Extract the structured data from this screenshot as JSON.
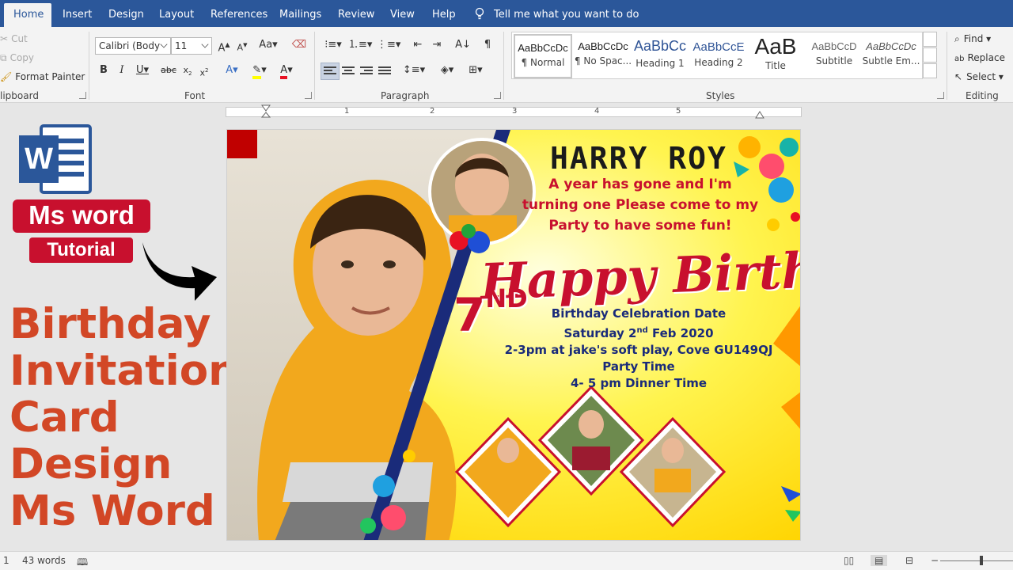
{
  "tabs": [
    {
      "label": "Home",
      "active": true
    },
    {
      "label": "Insert"
    },
    {
      "label": "Design"
    },
    {
      "label": "Layout"
    },
    {
      "label": "References"
    },
    {
      "label": "Mailings"
    },
    {
      "label": "Review"
    },
    {
      "label": "View"
    },
    {
      "label": "Help"
    }
  ],
  "tell_me": "Tell me what you want to do",
  "clipboard": {
    "cut": "Cut",
    "copy": "Copy",
    "format_painter": "Format Painter",
    "group_label": "lipboard"
  },
  "font": {
    "name": "Calibri (Body",
    "size": "11",
    "group_label": "Font"
  },
  "paragraph": {
    "group_label": "Paragraph"
  },
  "styles": {
    "group_label": "Styles",
    "items": [
      {
        "preview": "AaBbCcDc",
        "name": "¶ Normal"
      },
      {
        "preview": "AaBbCcDc",
        "name": "¶ No Spac..."
      },
      {
        "preview": "AaBbCc",
        "name": "Heading 1"
      },
      {
        "preview": "AaBbCcE",
        "name": "Heading 2"
      },
      {
        "preview": "AaB",
        "name": "Title"
      },
      {
        "preview": "AaBbCcD",
        "name": "Subtitle"
      },
      {
        "preview": "AaBbCcDc",
        "name": "Subtle Em..."
      }
    ]
  },
  "editing": {
    "find": "Find",
    "replace": "Replace",
    "select": "Select",
    "group_label": "Editing"
  },
  "ruler_numbers": [
    "1",
    "2",
    "3",
    "4",
    "5"
  ],
  "overlay": {
    "badge": "Ms word",
    "tutorial": "Tutorial",
    "title_lines": [
      "Birthday",
      "Invitation",
      "Card",
      "Design",
      "Ms Word"
    ]
  },
  "card": {
    "name": "HARRY ROY",
    "message_lines": [
      "A year has gone and I'm",
      "turning one Please come to my",
      "Party to have some fun!"
    ],
    "happy_birthday": "Happy Birthday",
    "age_number": "7",
    "age_suffix": "ND",
    "details": {
      "line1": "Birthday Celebration Date",
      "line2_prefix": "Saturday 2",
      "line2_sup": "nd",
      "line2_suffix": " Feb 2020",
      "line3": "2-3pm at jake's soft play, Cove GU149QJ",
      "line4": "Party Time",
      "line5": "4- 5 pm Dinner Time"
    }
  },
  "status": {
    "page": "1",
    "words": "43 words"
  },
  "colors": {
    "word_blue": "#2b579a",
    "accent_red": "#c8102e",
    "title_orange": "#d24726",
    "detail_blue": "#1a2b7a",
    "card_yellow": "#fff200"
  }
}
